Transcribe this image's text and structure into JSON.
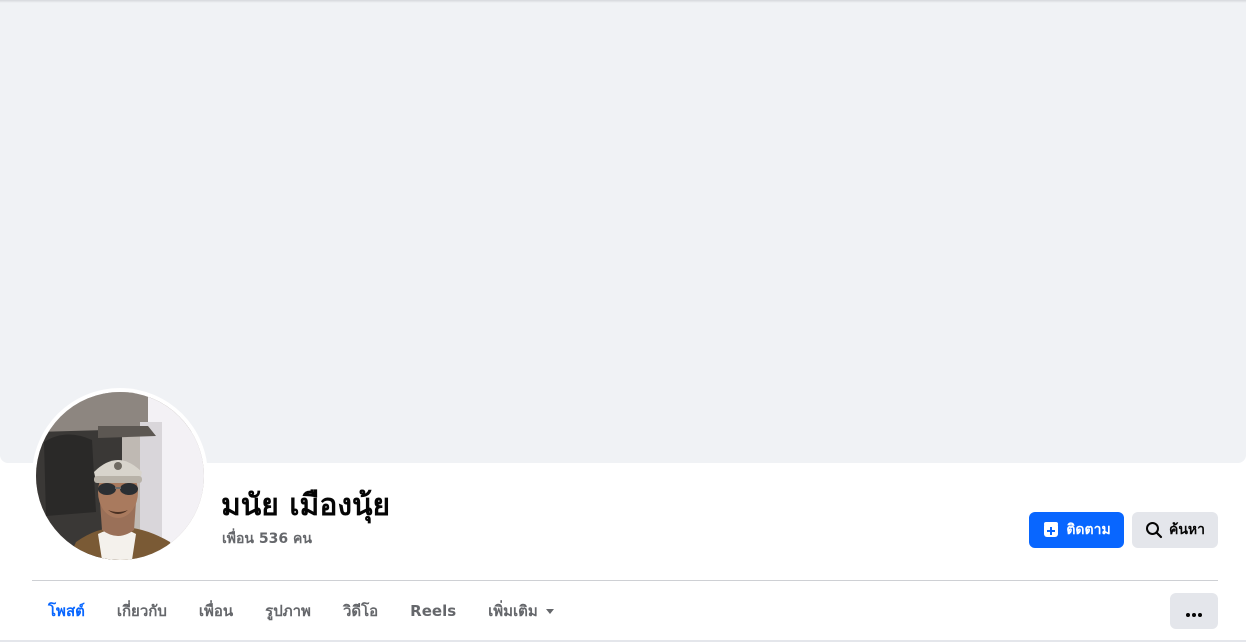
{
  "profile": {
    "name": "มนัย เมืองนุ้ย",
    "friends_text": "เพื่อน 536 คน"
  },
  "actions": {
    "follow_label": "ติดตาม",
    "search_label": "ค้นหา"
  },
  "tabs": [
    {
      "label": "โพสต์",
      "active": true
    },
    {
      "label": "เกี่ยวกับ",
      "active": false
    },
    {
      "label": "เพื่อน",
      "active": false
    },
    {
      "label": "รูปภาพ",
      "active": false
    },
    {
      "label": "วิดีโอ",
      "active": false
    },
    {
      "label": "Reels",
      "active": false
    },
    {
      "label": "เพิ่มเติม",
      "active": false
    }
  ],
  "icons": {
    "follow": "follow-plus-icon",
    "search": "search-icon",
    "more_caret": "caret-down-icon",
    "more_options": "more-options-icon"
  },
  "colors": {
    "accent": "#0866ff",
    "cover": "#f0f2f5",
    "secondary_button": "#e4e6eb",
    "text_primary": "#050505",
    "text_secondary": "#65676b"
  }
}
